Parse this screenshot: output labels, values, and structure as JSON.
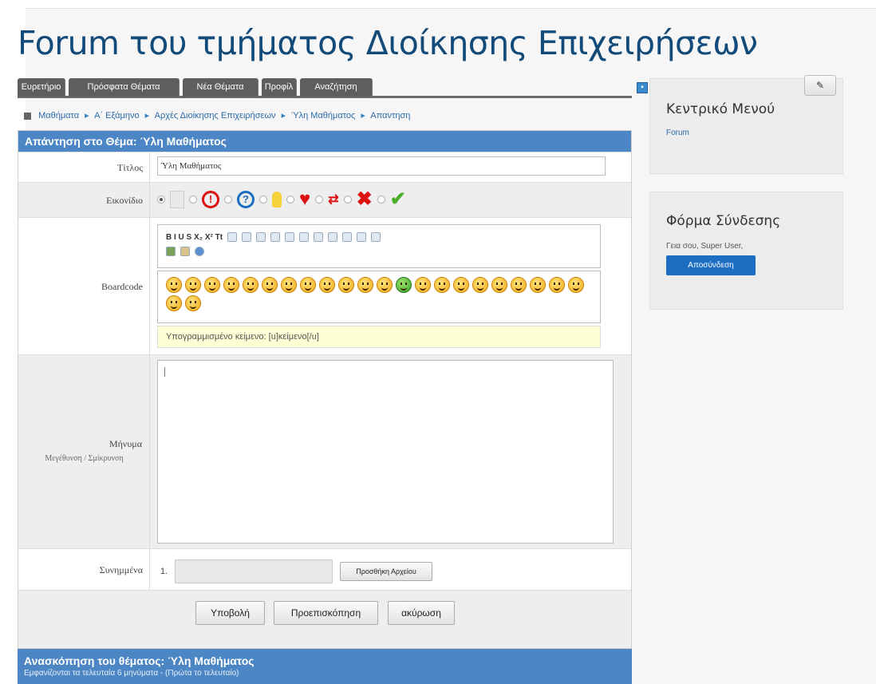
{
  "site": {
    "title": "Forum του τμήματος Διοίκησης Επιχειρήσεων"
  },
  "tabs": [
    {
      "label": "Ευρετήριο"
    },
    {
      "label": "Πρόσφατα Θέματα"
    },
    {
      "label": "Νέα Θέματα"
    },
    {
      "label": "Προφίλ"
    },
    {
      "label": "Αναζήτηση"
    }
  ],
  "breadcrumb": [
    {
      "label": "Μαθήματα"
    },
    {
      "label": "Α΄ Εξάμηνο"
    },
    {
      "label": "Αρχές Διοίκησης Επιχειρήσεων"
    },
    {
      "label": "Ύλη Μαθήματος"
    },
    {
      "label": "Απαντηση"
    }
  ],
  "form": {
    "header": "Απάντηση στο Θέμα: Ύλη Μαθήματος",
    "title_label": "Τίτλος",
    "title_value": "Ύλη Μαθήματος",
    "icon_label": "Εικονίδιο",
    "boardcode_label": "Boardcode",
    "toolbar_line1": "B I U S X₂ X² Tt",
    "help_text": "Υπογραμμισμένο κείμενο: [u]κείμενο[/u]",
    "message_label": "Μήνυμα",
    "resize_text": "Μεγέθυνση / Σμίκρυνση",
    "attachments_label": "Συνημμένα",
    "attachment_number": "1.",
    "add_file_label": "Προσθήκη Αρχείου",
    "submit_label": "Υποβολή",
    "preview_label": "Προεπισκόπηση",
    "cancel_label": "ακύρωση"
  },
  "review": {
    "title": "Ανασκόπηση του θέματος: Ύλη Μαθήματος",
    "subtitle": "Εμφανίζονται τα τελευταία 6 μηνύματα - (Πρώτα το τελευταίο)"
  },
  "sidebar": {
    "menu_title": "Κεντρικό Μενού",
    "menu_link": "Forum",
    "login_title": "Φόρμα Σύνδεσης",
    "greeting": "Γεια σου, Super User,",
    "logout_label": "Αποσύνδεση"
  },
  "colors": {
    "accent": "#4d86c4",
    "title": "#124b7a",
    "tab": "#5e5e5e",
    "button": "#1b6ec2"
  }
}
